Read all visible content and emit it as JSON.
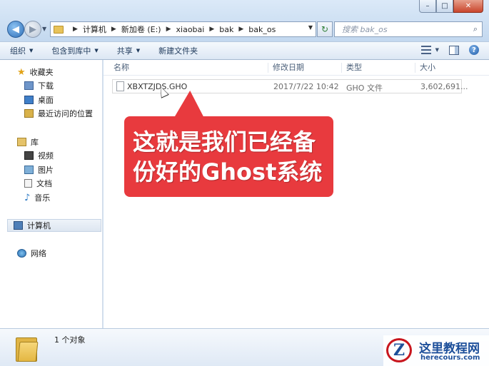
{
  "window": {
    "minimize": "–",
    "maximize": "□",
    "close": "✕"
  },
  "address": {
    "crumbs": [
      "计算机",
      "新加卷 (E:)",
      "xiaobai",
      "bak",
      "bak_os"
    ]
  },
  "search": {
    "placeholder": "搜索 bak_os"
  },
  "toolbar": {
    "organize": "组织",
    "include_library": "包含到库中",
    "share": "共享",
    "new_folder": "新建文件夹"
  },
  "nav": {
    "favorites": "收藏夹",
    "downloads": "下载",
    "desktop": "桌面",
    "recent": "最近访问的位置",
    "libraries": "库",
    "videos": "视频",
    "pictures": "图片",
    "documents": "文档",
    "music": "音乐",
    "computer": "计算机",
    "network": "网络"
  },
  "columns": {
    "name": "名称",
    "modified": "修改日期",
    "type": "类型",
    "size": "大小"
  },
  "files": [
    {
      "name": "XBXTZJDS.GHO",
      "modified": "2017/7/22 10:42",
      "type": "GHO 文件",
      "size": "3,602,691..."
    }
  ],
  "callout": {
    "line1": "这就是我们已经备",
    "line2": "份好的Ghost系统"
  },
  "details": {
    "count": "1 个对象"
  },
  "watermark": {
    "logo": "Z",
    "title": "这里教程网",
    "url": "herecours.com"
  },
  "colors": {
    "callout": "#e83a3e",
    "accent": "#1d4f9a"
  }
}
